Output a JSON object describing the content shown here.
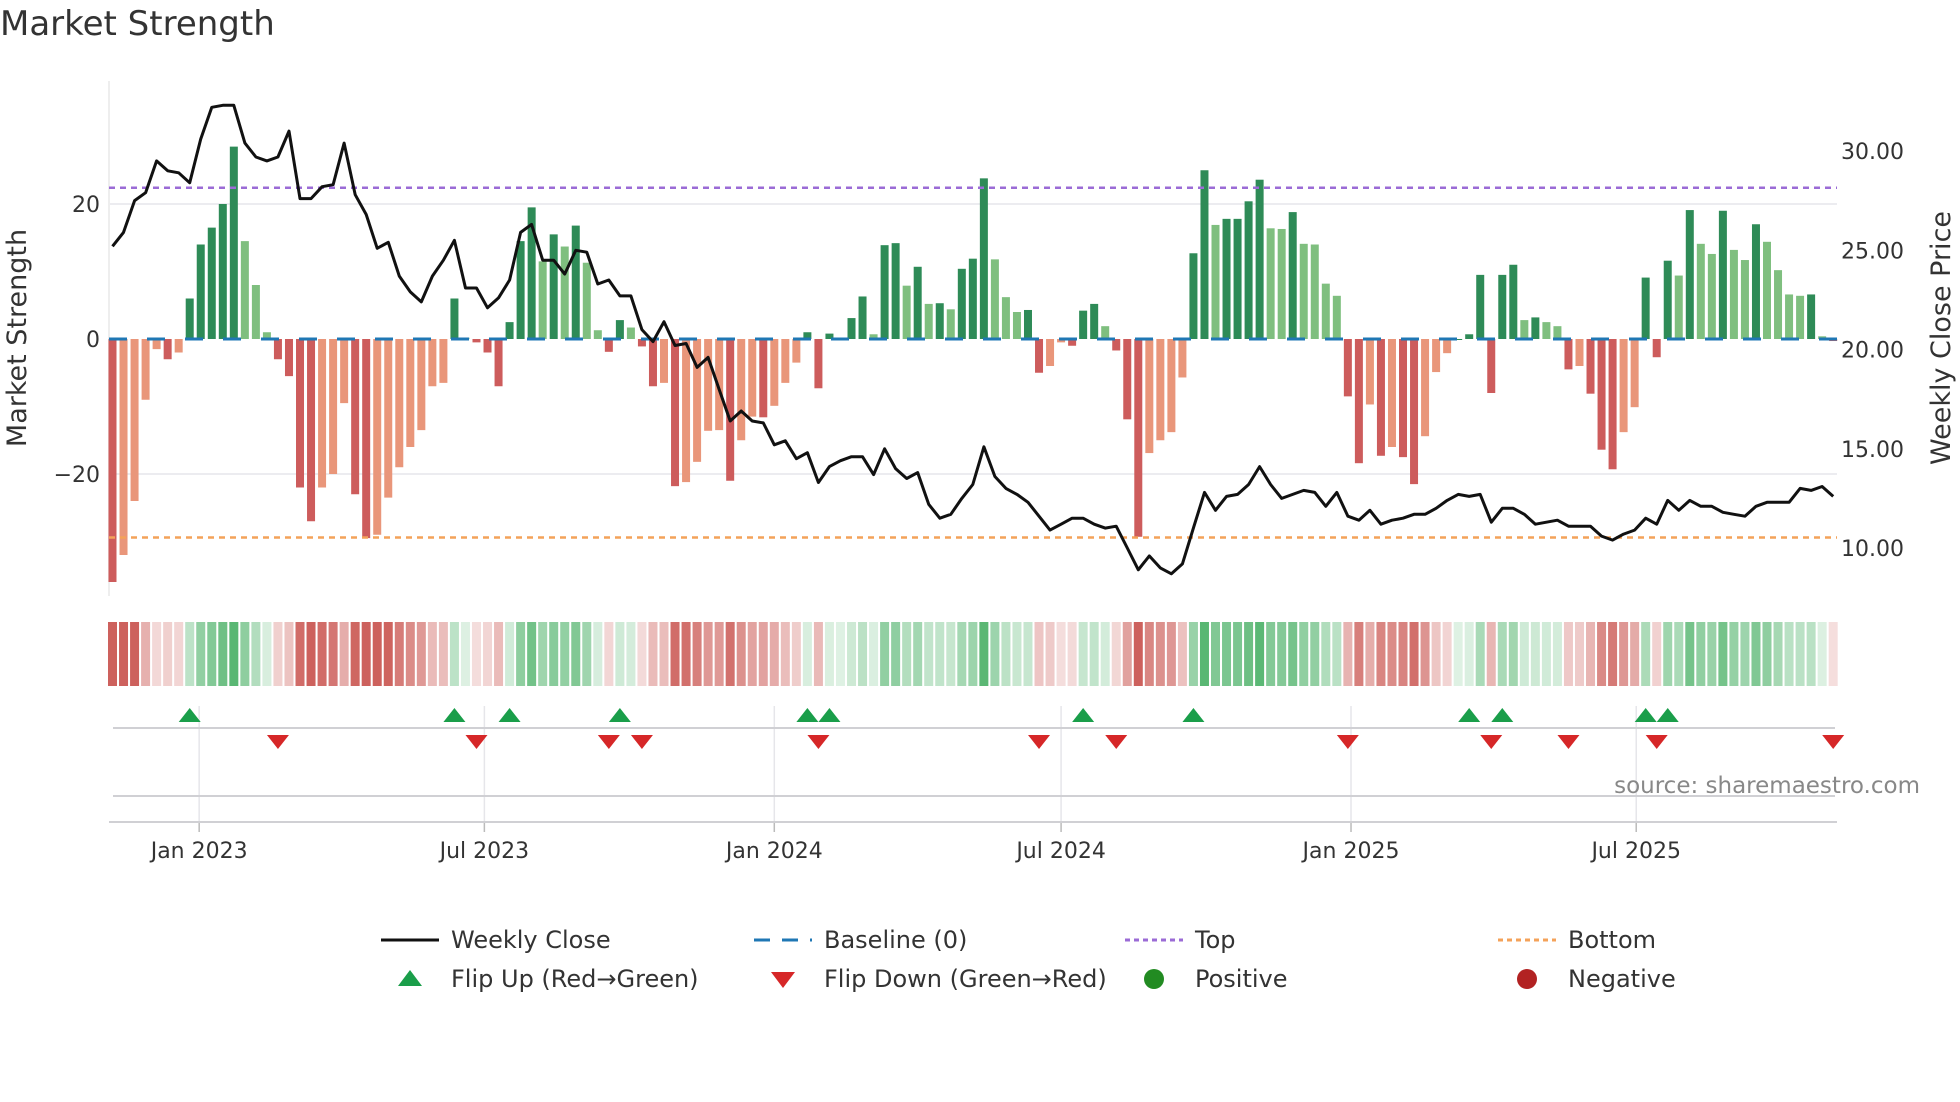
{
  "chart_data": {
    "type": "bar",
    "title": "Market Strength",
    "ylabel": "Market Strength",
    "y2label": "Weekly Close Price",
    "source": "source: sharemaestro.com",
    "start_date": "2022-11-07",
    "interval": "weekly",
    "ylim": [
      -38,
      38
    ],
    "y2lim": [
      8,
      34
    ],
    "yticks": [
      {
        "value": 20,
        "label": "20"
      },
      {
        "value": 0,
        "label": "0"
      },
      {
        "value": -20,
        "label": "−20"
      }
    ],
    "y2ticks": [
      {
        "value": 30,
        "label": "30.00"
      },
      {
        "value": 25,
        "label": "25.00"
      },
      {
        "value": 20,
        "label": "20.00"
      },
      {
        "value": 15,
        "label": "15.00"
      },
      {
        "value": 10,
        "label": "10.00"
      }
    ],
    "xticks": [
      {
        "date": "2023-01-01",
        "label": "Jan 2023"
      },
      {
        "date": "2023-07-01",
        "label": "Jul 2023"
      },
      {
        "date": "2024-01-01",
        "label": "Jan 2024"
      },
      {
        "date": "2024-07-01",
        "label": "Jul 2024"
      },
      {
        "date": "2025-01-01",
        "label": "Jan 2025"
      },
      {
        "date": "2025-07-01",
        "label": "Jul 2025"
      }
    ],
    "top_level": 22.4,
    "bottom_level": -29.4,
    "baseline": 0,
    "strength": [
      -36,
      -32,
      -24,
      -9,
      -1.5,
      -3,
      -2,
      6,
      14,
      16.5,
      20,
      28.5,
      14.5,
      8,
      1,
      -3,
      -5.5,
      -22,
      -27,
      -22,
      -20,
      -9.5,
      -23,
      -29.5,
      -29,
      -23.5,
      -19,
      -16,
      -13.5,
      -7,
      -6.5,
      6,
      0.2,
      -0.5,
      -2,
      -7,
      2.5,
      14.5,
      19.5,
      11.5,
      15.5,
      13.7,
      16.8,
      11.3,
      1.3,
      -1.9,
      2.8,
      1.7,
      -1.1,
      -7,
      -6.5,
      -21.8,
      -21.2,
      -18.2,
      -13.6,
      -13.5,
      -21,
      -15,
      -11.5,
      -11.6,
      -9.9,
      -6.5,
      -3.5,
      1,
      -7.3,
      0.8,
      0,
      3.1,
      6.3,
      0.7,
      13.9,
      14.2,
      7.9,
      10.7,
      5.2,
      5.3,
      4.4,
      10.4,
      11.9,
      23.8,
      11.8,
      6.2,
      4,
      4.3,
      -5,
      -4,
      -0.5,
      -1,
      4.2,
      5.2,
      1.9,
      -1.7,
      -11.9,
      -29.3,
      -16.9,
      -15,
      -13.8,
      -5.7,
      12.7,
      25,
      16.9,
      17.8,
      17.8,
      20.4,
      23.6,
      16.4,
      16.3,
      18.8,
      14.1,
      14,
      8.2,
      6.4,
      -8.5,
      -18.4,
      -9.7,
      -17.3,
      -16,
      -17.5,
      -21.5,
      -14.4,
      -4.9,
      -2.1,
      0,
      0.7,
      9.5,
      -8,
      9.5,
      11,
      2.8,
      3.2,
      2.5,
      1.9,
      -4.5,
      -4,
      -8.1,
      -16.4,
      -19.3,
      -13.8,
      -10.1,
      9.1,
      -2.7,
      11.6,
      9.4,
      19.1,
      14.1,
      12.6,
      19,
      13.2,
      11.7,
      17,
      14.4,
      10.2,
      6.6,
      6.4,
      6.6,
      0.4,
      -0.3
    ],
    "close": [
      25.2,
      25.9,
      27.5,
      27.9,
      29.5,
      29.0,
      28.9,
      28.4,
      30.6,
      32.2,
      32.3,
      32.3,
      30.4,
      29.7,
      29.5,
      29.7,
      31.0,
      27.6,
      27.6,
      28.2,
      28.3,
      30.4,
      27.8,
      26.8,
      25.1,
      25.4,
      23.7,
      22.9,
      22.4,
      23.7,
      24.5,
      25.5,
      23.1,
      23.1,
      22.1,
      22.6,
      23.5,
      25.9,
      26.3,
      24.5,
      24.5,
      23.8,
      25.0,
      24.9,
      23.3,
      23.5,
      22.7,
      22.7,
      21.0,
      20.4,
      21.4,
      20.2,
      20.3,
      19.1,
      19.6,
      18.0,
      16.4,
      16.9,
      16.4,
      16.3,
      15.2,
      15.4,
      14.5,
      14.8,
      13.3,
      14.1,
      14.4,
      14.6,
      14.6,
      13.7,
      15.0,
      14.0,
      13.5,
      13.8,
      12.2,
      11.5,
      11.7,
      12.5,
      13.2,
      15.1,
      13.6,
      13.0,
      12.7,
      12.3,
      11.6,
      10.9,
      11.2,
      11.5,
      11.5,
      11.2,
      11.0,
      11.1,
      10.0,
      8.9,
      9.6,
      9.0,
      8.7,
      9.2,
      11.0,
      12.8,
      11.9,
      12.6,
      12.7,
      13.2,
      14.1,
      13.2,
      12.5,
      12.7,
      12.9,
      12.8,
      12.1,
      12.8,
      11.6,
      11.4,
      11.9,
      11.2,
      11.4,
      11.5,
      11.7,
      11.7,
      12.0,
      12.4,
      12.7,
      12.6,
      12.7,
      11.3,
      12.0,
      12.0,
      11.7,
      11.2,
      11.3,
      11.4,
      11.1,
      11.1,
      11.1,
      10.6,
      10.4,
      10.7,
      10.9,
      11.5,
      11.2,
      12.4,
      11.9,
      12.4,
      12.1,
      12.1,
      11.8,
      11.7,
      11.6,
      12.1,
      12.3,
      12.3,
      12.3,
      13.0,
      12.9,
      13.1,
      12.6
    ],
    "flip_up_weeks": [
      7,
      31,
      36,
      46,
      63,
      65,
      88,
      98,
      123,
      126,
      139,
      141
    ],
    "flip_down_weeks": [
      15,
      33,
      45,
      48,
      64,
      84,
      91,
      112,
      125,
      132,
      140,
      156
    ],
    "colors": {
      "pos_rising": "#2e8b57",
      "pos_falling": "#7fbf7f",
      "neg_falling": "#cd5c5c",
      "neg_rising": "#e9967a",
      "close": "#111111",
      "baseline": "#1f77b4",
      "top": "#9b6bd6",
      "bottom": "#f4a259",
      "flip_up": "#1a9e4a",
      "flip_down": "#d62728",
      "positive": "#228b22",
      "negative": "#b22222"
    },
    "legend": [
      {
        "label": "Weekly Close",
        "kind": "line"
      },
      {
        "label": "Baseline (0)",
        "kind": "dash"
      },
      {
        "label": "Top",
        "kind": "dot-purple"
      },
      {
        "label": "Bottom",
        "kind": "dot-orange"
      },
      {
        "label": "Flip Up (Red→Green)",
        "kind": "tri-up"
      },
      {
        "label": "Flip Down (Green→Red)",
        "kind": "tri-down"
      },
      {
        "label": "Positive",
        "kind": "circle-green"
      },
      {
        "label": "Negative",
        "kind": "circle-red"
      }
    ]
  }
}
